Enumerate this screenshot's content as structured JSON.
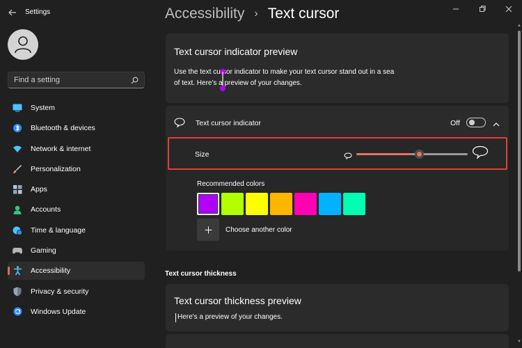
{
  "window": {
    "title": "Settings"
  },
  "search": {
    "placeholder": "Find a setting"
  },
  "sidebar": {
    "items": [
      {
        "label": "System",
        "icon": "monitor-icon"
      },
      {
        "label": "Bluetooth & devices",
        "icon": "bluetooth-icon"
      },
      {
        "label": "Network & internet",
        "icon": "wifi-icon"
      },
      {
        "label": "Personalization",
        "icon": "brush-icon"
      },
      {
        "label": "Apps",
        "icon": "apps-icon"
      },
      {
        "label": "Accounts",
        "icon": "person-icon"
      },
      {
        "label": "Time & language",
        "icon": "globe-clock-icon"
      },
      {
        "label": "Gaming",
        "icon": "gamepad-icon"
      },
      {
        "label": "Accessibility",
        "icon": "accessibility-icon",
        "active": true
      },
      {
        "label": "Privacy & security",
        "icon": "shield-icon"
      },
      {
        "label": "Windows Update",
        "icon": "update-icon"
      }
    ]
  },
  "header": {
    "breadcrumb_parent": "Accessibility",
    "breadcrumb_current": "Text cursor"
  },
  "preview_card": {
    "title": "Text cursor indicator preview",
    "description_line1": "Use the text cursor indicator to make your text cursor stand out in a sea",
    "description_line2": "of text. Here's a preview of your changes."
  },
  "indicator_setting": {
    "label": "Text cursor indicator",
    "state_label": "Off",
    "enabled": false
  },
  "size_setting": {
    "label": "Size",
    "value_fraction": 0.5
  },
  "colors": {
    "heading": "Recommended colors",
    "swatches": [
      "#b200ff",
      "#b2ff00",
      "#ffff00",
      "#ffb600",
      "#ff00b2",
      "#00b2ff",
      "#00ffb2"
    ],
    "selected_index": 0,
    "choose_another_label": "Choose another color"
  },
  "thickness_section": {
    "heading": "Text cursor thickness",
    "preview_title": "Text cursor thickness preview",
    "preview_text": "Here's a preview of your changes."
  },
  "accent_color": "#e8735f"
}
